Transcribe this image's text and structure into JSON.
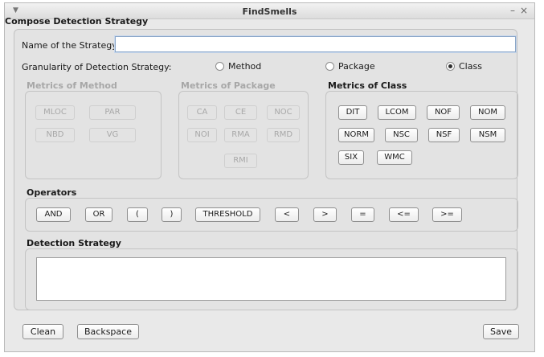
{
  "window": {
    "title": "FindSmells",
    "menu_icon": "chevron-down-icon",
    "minimize_glyph": "–",
    "close_glyph": "×"
  },
  "heading": "Compose Detection Strategy",
  "name_field": {
    "label": "Name of the Strategy:",
    "value": ""
  },
  "granularity": {
    "label": "Granularity of Detection Strategy:",
    "options": [
      "Method",
      "Package",
      "Class"
    ],
    "selected": "Class"
  },
  "metrics_method": {
    "title": "Metrics of Method",
    "buttons": [
      "MLOC",
      "PAR",
      "NBD",
      "VG"
    ],
    "enabled": false
  },
  "metrics_package": {
    "title": "Metrics of Package",
    "buttons": [
      "CA",
      "CE",
      "NOC",
      "NOI",
      "RMA",
      "RMD",
      "RMI"
    ],
    "enabled": false
  },
  "metrics_class": {
    "title": "Metrics of Class",
    "buttons": [
      "DIT",
      "LCOM",
      "NOF",
      "NOM",
      "NORM",
      "NSC",
      "NSF",
      "NSM",
      "SIX",
      "WMC"
    ],
    "enabled": true
  },
  "operators": {
    "title": "Operators",
    "buttons": [
      "AND",
      "OR",
      "(",
      ")",
      "THRESHOLD",
      "<",
      ">",
      "=",
      "<=",
      ">="
    ]
  },
  "detection_strategy": {
    "title": "Detection Strategy",
    "value": ""
  },
  "footer": {
    "clean": "Clean",
    "backspace": "Backspace",
    "save": "Save"
  },
  "colors": {
    "window_bg": "#e9e9e9",
    "panel_bg": "#e3e3e3",
    "disabled_text": "#a7a7a7",
    "input_focus_border": "#8aa6c8"
  }
}
